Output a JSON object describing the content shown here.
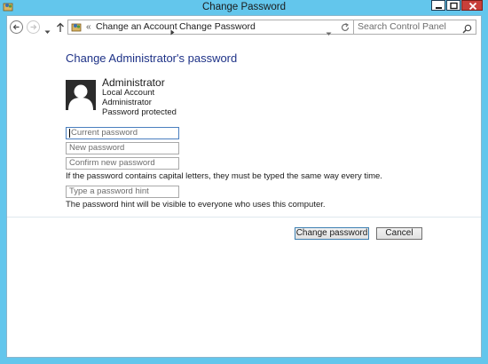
{
  "window": {
    "title": "Change Password"
  },
  "navbar": {
    "breadcrumbs": [
      "Change an Account",
      "Change Password"
    ],
    "overflow_chevron": "«",
    "search_placeholder": "Search Control Panel"
  },
  "content": {
    "heading": "Change Administrator's password",
    "user": {
      "name": "Administrator",
      "details": [
        "Local Account",
        "Administrator",
        "Password protected"
      ]
    },
    "fields": {
      "current_password": "Current password",
      "new_password": "New password",
      "confirm_password": "Confirm new password",
      "password_hint": "Type a password hint"
    },
    "capital_note": "If the password contains capital letters, they must be typed the same way every time.",
    "hint_note": "The password hint will be visible to everyone who uses this computer."
  },
  "buttons": {
    "change_password": "Change password",
    "cancel": "Cancel"
  },
  "colors": {
    "frame": "#63c6ec",
    "heading": "#1e3287",
    "close_button": "#c8403a"
  }
}
